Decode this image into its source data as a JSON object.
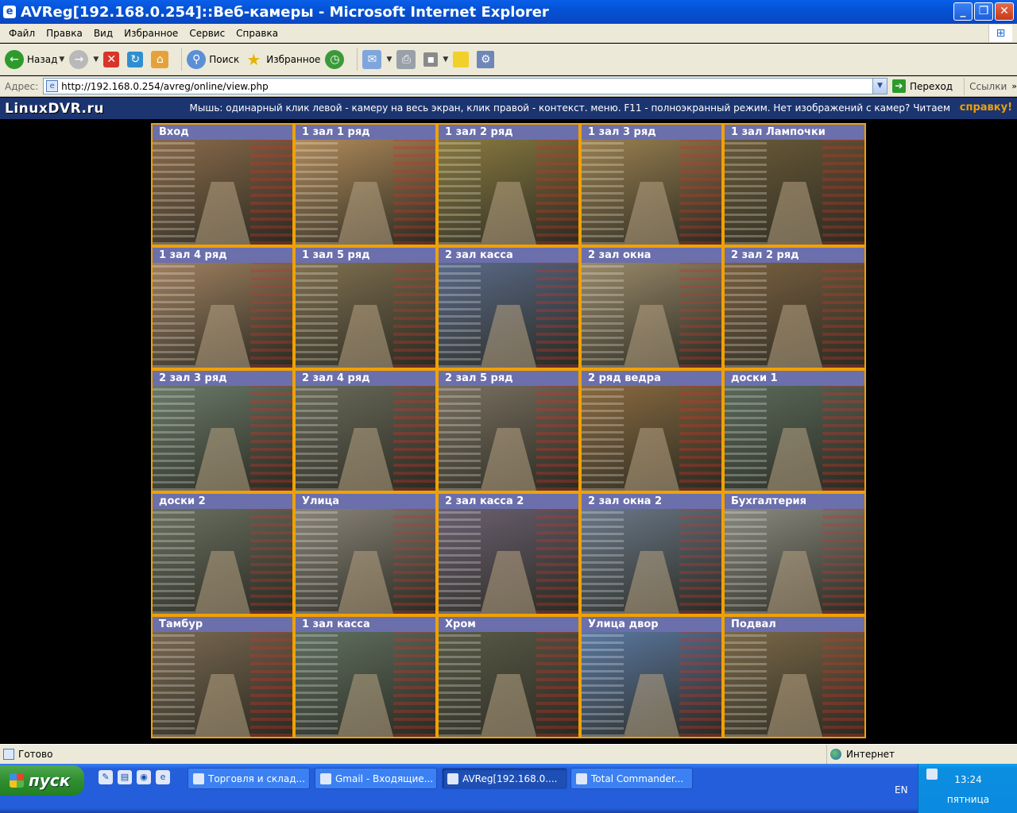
{
  "window": {
    "title": "AVReg[192.168.0.254]::Веб-камеры - Microsoft Internet Explorer",
    "minimize": "_",
    "maximize": "❐",
    "close": "✕"
  },
  "menu": [
    "Файл",
    "Правка",
    "Вид",
    "Избранное",
    "Сервис",
    "Справка"
  ],
  "toolbar": {
    "back_label": "Назад",
    "search_label": "Поиск",
    "favorites_label": "Избранное"
  },
  "address": {
    "label": "Адрес:",
    "url": "http://192.168.0.254/avreg/online/view.php",
    "go_label": "Переход",
    "links_label": "Ссылки"
  },
  "page": {
    "brand": "LinuxDVR.ru",
    "hint": "Мышь: одинарный клик левой - камеру на весь экран, клик правой - контекст. меню.  F11 - полноэкранный режим.   Нет изображений с камер? Читаем",
    "help_link": "справку!",
    "cameras": [
      {
        "title": "Вход",
        "tint": "#8a6a4a"
      },
      {
        "title": "1 зал 1 ряд",
        "tint": "#b08a5a"
      },
      {
        "title": "1 зал 2 ряд",
        "tint": "#8a7a40"
      },
      {
        "title": "1 зал 3 ряд",
        "tint": "#9a8050"
      },
      {
        "title": "1 зал Лампочки",
        "tint": "#6a5a38"
      },
      {
        "title": "1 зал 4 ряд",
        "tint": "#a08060"
      },
      {
        "title": "1 зал 5 ряд",
        "tint": "#807050"
      },
      {
        "title": "2 зал касса",
        "tint": "#5a6a88"
      },
      {
        "title": "2 зал окна",
        "tint": "#9a8a6a"
      },
      {
        "title": "2 зал 2 ряд",
        "tint": "#7a6040"
      },
      {
        "title": "2 зал 3 ряд",
        "tint": "#6a7a68"
      },
      {
        "title": "2 зал 4 ряд",
        "tint": "#6a6a5a"
      },
      {
        "title": "2 зал 5 ряд",
        "tint": "#7a7060"
      },
      {
        "title": "2 ряд ведра",
        "tint": "#8a6a40"
      },
      {
        "title": "доски 1",
        "tint": "#5a6a5a"
      },
      {
        "title": "доски 2",
        "tint": "#6a7060"
      },
      {
        "title": "Улица",
        "tint": "#8a8478"
      },
      {
        "title": "2 зал касса 2",
        "tint": "#6a6070"
      },
      {
        "title": "2 зал окна 2",
        "tint": "#6a7888"
      },
      {
        "title": "Бухгалтерия",
        "tint": "#8a8a80"
      },
      {
        "title": "Тамбур",
        "tint": "#7a6850"
      },
      {
        "title": "1 зал касса",
        "tint": "#607060"
      },
      {
        "title": "Хром",
        "tint": "#5a5a48"
      },
      {
        "title": "Улица двор",
        "tint": "#5a78a0"
      },
      {
        "title": "Подвал",
        "tint": "#7a6848"
      }
    ]
  },
  "status": {
    "text": "Готово",
    "zone": "Интернет"
  },
  "taskbar": {
    "start_label": "пуск",
    "tasks": [
      {
        "label": "Торговля и склад..."
      },
      {
        "label": "Gmail - Входящие..."
      },
      {
        "label": "AVReg[192.168.0...."
      },
      {
        "label": "Total Commander..."
      }
    ],
    "lang": "EN",
    "time": "13:24",
    "day": "пятница"
  }
}
